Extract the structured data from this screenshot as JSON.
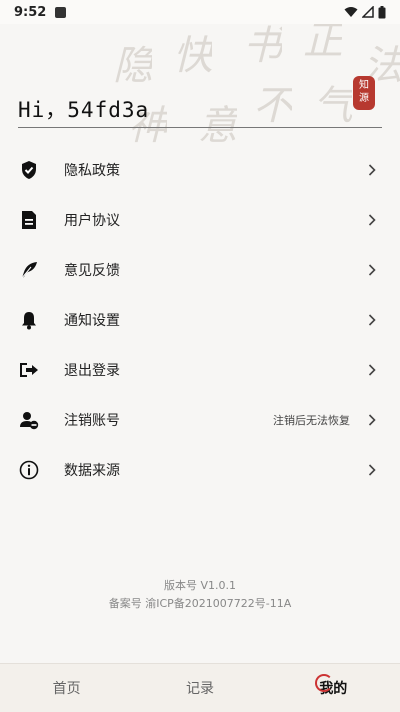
{
  "status_bar": {
    "time": "9:52"
  },
  "header": {
    "greeting": "Hi，54fd3a",
    "seal_chars": [
      "知",
      "源"
    ]
  },
  "menu": {
    "items": [
      {
        "label": "隐私政策",
        "icon": "shield-check-icon",
        "hint": ""
      },
      {
        "label": "用户协议",
        "icon": "document-icon",
        "hint": ""
      },
      {
        "label": "意见反馈",
        "icon": "feather-icon",
        "hint": ""
      },
      {
        "label": "通知设置",
        "icon": "bell-icon",
        "hint": ""
      },
      {
        "label": "退出登录",
        "icon": "logout-icon",
        "hint": ""
      },
      {
        "label": "注销账号",
        "icon": "user-remove-icon",
        "hint": "注销后无法恢复"
      },
      {
        "label": "数据来源",
        "icon": "info-icon",
        "hint": ""
      }
    ]
  },
  "footer": {
    "version": "版本号 V1.0.1",
    "icp": "备案号 渝ICP备2021007722号-11A"
  },
  "tabbar": {
    "tabs": [
      {
        "label": "首页"
      },
      {
        "label": "记录"
      },
      {
        "label": "我的"
      }
    ],
    "active_index": 2
  },
  "colors": {
    "accent": "#b7392f",
    "background": "#f7f6f4"
  }
}
